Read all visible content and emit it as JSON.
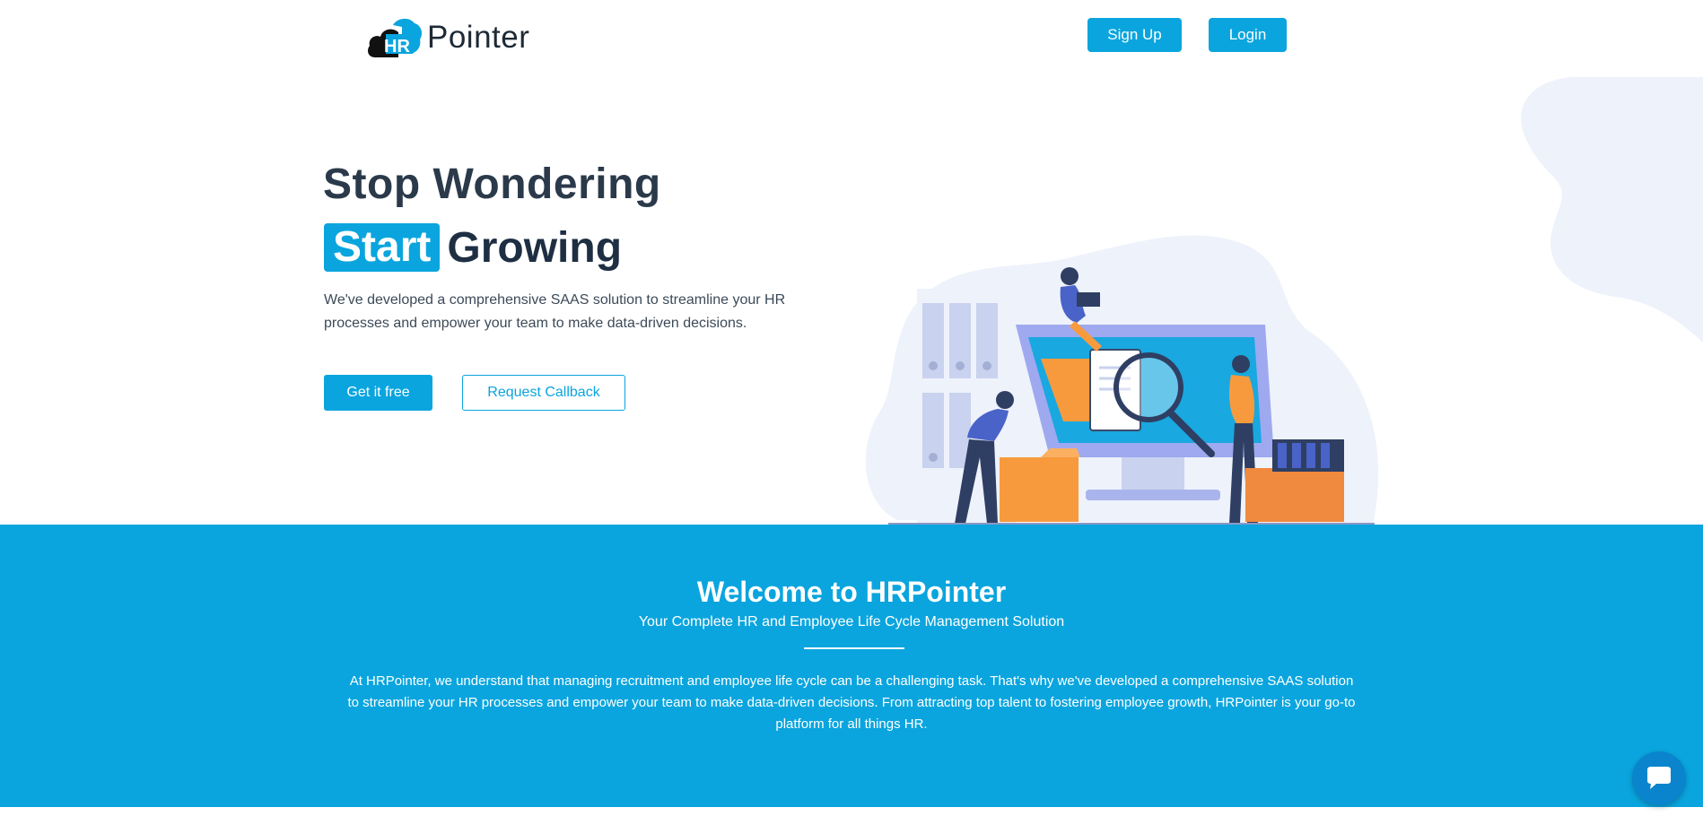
{
  "header": {
    "logo_text": "Pointer",
    "logo_badge": "HR",
    "signup_label": "Sign Up",
    "login_label": "Login"
  },
  "hero": {
    "title_line1": "Stop Wondering",
    "title_highlight": "Start",
    "title_rest": "Growing",
    "description": "We've developed a comprehensive SAAS solution to streamline your HR processes and empower your team to make data-driven decisions.",
    "cta_primary": "Get it free",
    "cta_secondary": "Request Callback"
  },
  "welcome": {
    "title": "Welcome to HRPointer",
    "subtitle": "Your Complete HR and Employee Life Cycle Management Solution",
    "body": "At HRPointer, we understand that managing recruitment and employee life cycle can be a challenging task. That's why we've developed a comprehensive SAAS solution to streamline your HR processes and empower your team to make data-driven decisions. From attracting top talent to fostering employee growth, HRPointer is your go-to platform for all things HR."
  },
  "icons": {
    "chat": "chat-icon",
    "logo": "hr-cloud-logo-icon"
  },
  "colors": {
    "accent": "#0aa5de",
    "heading": "#2b3a4a",
    "blob": "#eef2fb",
    "orange": "#f79a3e"
  }
}
